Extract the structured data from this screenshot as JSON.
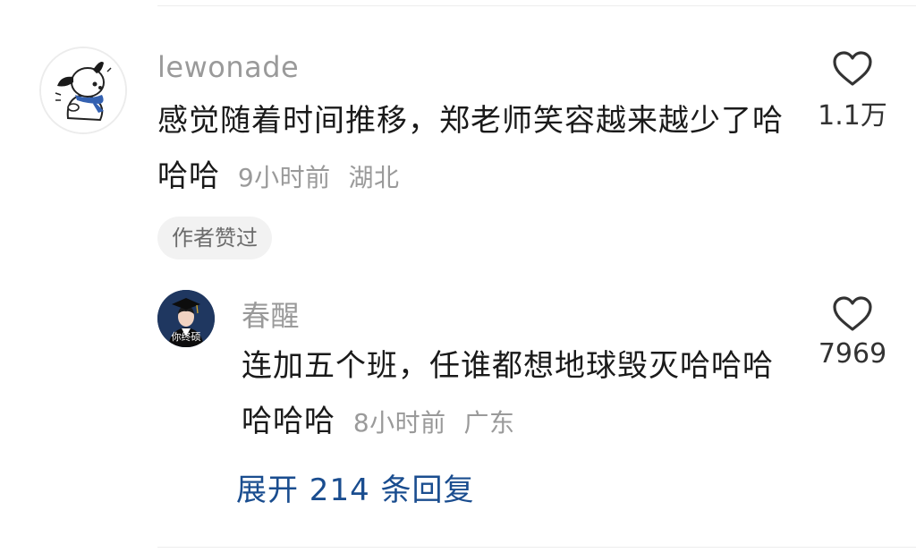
{
  "comment": {
    "username": "lewonade",
    "text": "感觉随着时间推移，郑老师笑容越来越少了哈哈哈",
    "time": "9小时前",
    "location": "湖北",
    "like_count": "1.1万",
    "author_badge": "作者赞过"
  },
  "reply": {
    "username": "春醒",
    "avatar_caption": "你终硕",
    "text": "连加五个班，任谁都想地球毁灭哈哈哈哈哈哈",
    "time": "8小时前",
    "location": "广东",
    "like_count": "7969"
  },
  "expand_replies_label": "展开 214 条回复",
  "colors": {
    "link": "#1a4d8f",
    "muted": "#9a9a9a",
    "text": "#1a1a1a"
  }
}
